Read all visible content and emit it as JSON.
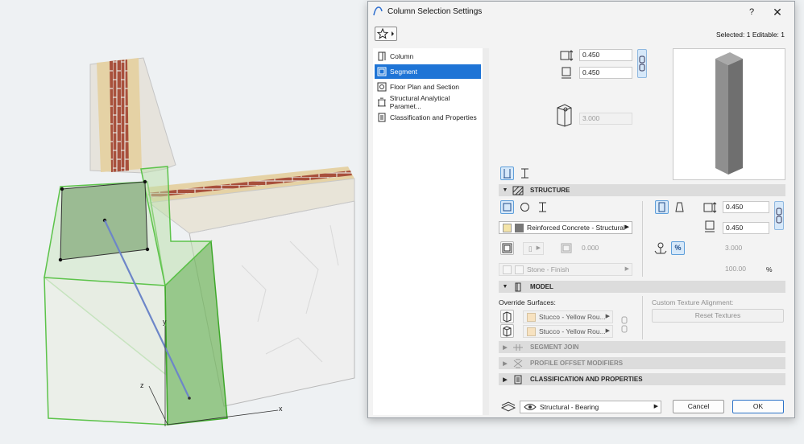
{
  "viewport": {
    "axis_x_label": "x",
    "axis_y_label": "y",
    "axis_z_label": "z"
  },
  "dialog": {
    "title": "Column Selection Settings",
    "help_label": "?",
    "close_label": "✕",
    "selected_info": "Selected: 1 Editable: 1"
  },
  "nav": {
    "items": [
      {
        "label": "Column",
        "icon": "column-icon"
      },
      {
        "label": "Segment",
        "icon": "segment-icon",
        "selected": true
      },
      {
        "label": "Floor Plan and Section",
        "icon": "floor-plan-icon"
      },
      {
        "label": "Structural Analytical Paramet...",
        "icon": "structural-analytical-icon"
      },
      {
        "label": "Classification and Properties",
        "icon": "classification-icon"
      }
    ]
  },
  "top": {
    "width_value": "0.450",
    "depth_value": "0.450",
    "height_value": "3.000"
  },
  "structure": {
    "section_label": "STRUCTURE",
    "material": "Reinforced Concrete - Structural",
    "offset_value": "0.000",
    "finish": "Stone - Finish",
    "end_width_value": "0.450",
    "end_depth_value": "0.450",
    "right_value": "3.000",
    "percent_value": "100.00",
    "percent_unit": "%",
    "percent_btn": "%",
    "brand_colors": {
      "accent": "#1e74d6",
      "selected_btn": "#d6e8f9"
    }
  },
  "model": {
    "section_label": "MODEL",
    "override_label": "Override Surfaces:",
    "surface1": "Stucco - Yellow Rou...",
    "surface2": "Stucco - Yellow Rou...",
    "texture_label": "Custom Texture Alignment:",
    "reset_label": "Reset Textures"
  },
  "sections": {
    "segment_join": "SEGMENT JOIN",
    "profile_offset": "PROFILE OFFSET MODIFIERS",
    "classification": "CLASSIFICATION AND PROPERTIES"
  },
  "footer": {
    "layer": "Structural - Bearing",
    "cancel_label": "Cancel",
    "ok_label": "OK"
  }
}
